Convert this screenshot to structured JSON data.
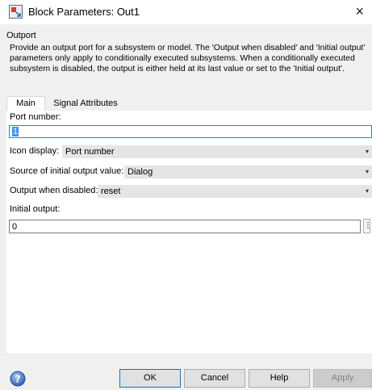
{
  "window": {
    "title": "Block Parameters: Out1",
    "close_glyph": "×"
  },
  "block": {
    "type_name": "Outport",
    "description": "Provide an output port for a subsystem or model.  The 'Output when disabled' and 'Initial output' parameters only apply to conditionally executed subsystems. When a conditionally executed subsystem is disabled, the output is either held at its last value or set to the 'Initial output'."
  },
  "tabs": [
    {
      "label": "Main",
      "active": true
    },
    {
      "label": "Signal Attributes",
      "active": false
    }
  ],
  "params": {
    "port_number": {
      "label": "Port number:",
      "value": "1"
    },
    "icon_display": {
      "label": "Icon display:",
      "value": "Port number"
    },
    "source_initial": {
      "label": "Source of initial output value:",
      "value": "Dialog"
    },
    "output_disabled": {
      "label": "Output when disabled:",
      "value": "reset"
    },
    "initial_output": {
      "label": "Initial output:",
      "value": "0",
      "more_glyph": "⋮"
    }
  },
  "buttons": {
    "ok": "OK",
    "cancel": "Cancel",
    "help": "Help",
    "apply": "Apply"
  },
  "icons": {
    "app": "simulink-block-icon",
    "help": "help-question-icon"
  },
  "colors": {
    "focus": "#3c7fb1",
    "selection": "#3399ff",
    "default_button_border": "#0078d7"
  }
}
